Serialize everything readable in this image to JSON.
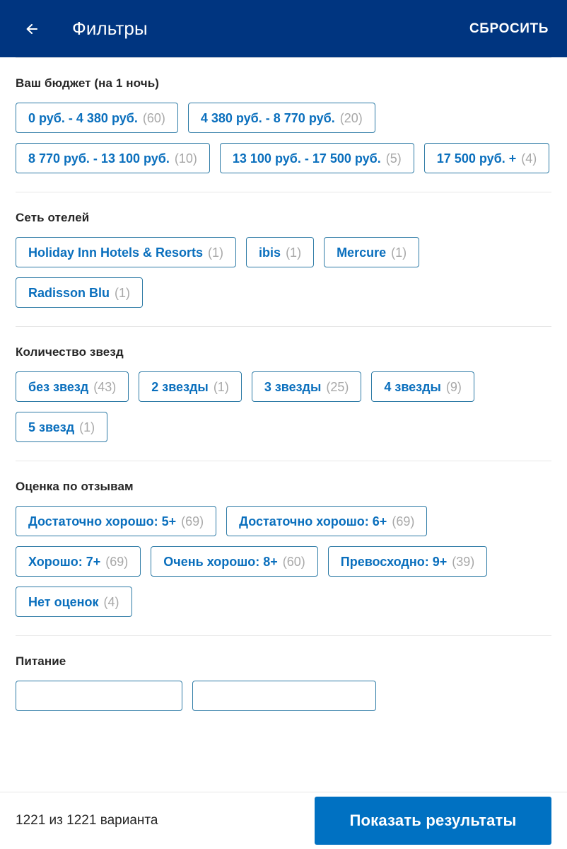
{
  "header": {
    "back_icon": "arrow-left-icon",
    "title": "Фильтры",
    "reset_label": "СБРОСИТЬ",
    "background": "#003580"
  },
  "sections": [
    {
      "key": "budget",
      "title": "Ваш бюджет (на 1 ночь)",
      "chips": [
        {
          "label": "0 руб. - 4 380 руб.",
          "count": "(60)"
        },
        {
          "label": "4 380 руб. - 8 770 руб.",
          "count": "(20)"
        },
        {
          "label": "8 770 руб. - 13 100 руб.",
          "count": "(10)"
        },
        {
          "label": "13 100 руб. - 17 500 руб.",
          "count": "(5)"
        },
        {
          "label": "17 500 руб. +",
          "count": "(4)"
        }
      ]
    },
    {
      "key": "hotel-chain",
      "title": "Сеть отелей",
      "chips": [
        {
          "label": "Holiday Inn Hotels & Resorts",
          "count": "(1)"
        },
        {
          "label": "ibis",
          "count": "(1)"
        },
        {
          "label": "Mercure",
          "count": "(1)"
        },
        {
          "label": "Radisson Blu",
          "count": "(1)"
        }
      ]
    },
    {
      "key": "stars",
      "title": "Количество звезд",
      "chips": [
        {
          "label": "без звезд",
          "count": "(43)"
        },
        {
          "label": "2 звезды",
          "count": "(1)"
        },
        {
          "label": "3 звезды",
          "count": "(25)"
        },
        {
          "label": "4 звезды",
          "count": "(9)"
        },
        {
          "label": "5 звезд",
          "count": "(1)"
        }
      ]
    },
    {
      "key": "review-score",
      "title": "Оценка по отзывам",
      "chips": [
        {
          "label": "Достаточно хорошо: 5+",
          "count": "(69)"
        },
        {
          "label": "Достаточно хорошо: 6+",
          "count": "(69)"
        },
        {
          "label": "Хорошо: 7+",
          "count": "(69)"
        },
        {
          "label": "Очень хорошо: 8+",
          "count": "(60)"
        },
        {
          "label": "Превосходно: 9+",
          "count": "(39)"
        },
        {
          "label": "Нет оценок",
          "count": "(4)"
        }
      ]
    },
    {
      "key": "meals",
      "title": "Питание",
      "chips": [
        {
          "label": "",
          "count": ""
        },
        {
          "label": "",
          "count": ""
        }
      ]
    }
  ],
  "footer": {
    "results_count": "1221 из 1221 варианта",
    "cta_label": "Показать результаты",
    "cta_color": "#0071c2"
  }
}
